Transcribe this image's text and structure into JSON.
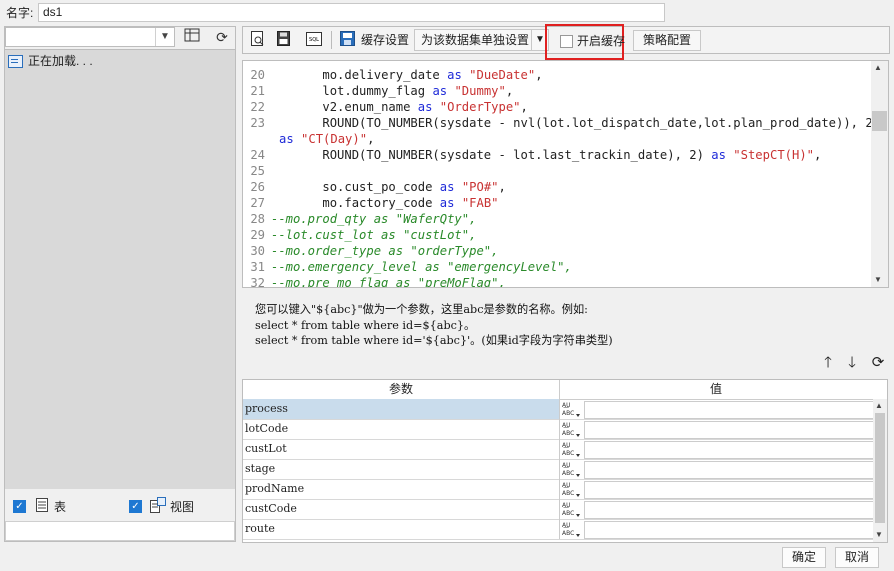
{
  "name_row": {
    "label": "名字:",
    "value": "ds1"
  },
  "left": {
    "db_select_value": "",
    "loading_text": "正在加载. . .",
    "table_check_label": "表",
    "view_check_label": "视图",
    "filter_value": ""
  },
  "toolbar": {
    "cache_settings_label": "缓存设置",
    "cache_mode_value": "为该数据集单独设置",
    "enable_cache_label": "开启缓存",
    "strategy_button_label": "策略配置"
  },
  "code_lines": [
    {
      "n": "20",
      "indent": "       ",
      "parts": [
        {
          "t": "mo.delivery_date ",
          "c": ""
        },
        {
          "t": "as",
          "c": "kw"
        },
        {
          "t": " ",
          "c": ""
        },
        {
          "t": "\"DueDate\"",
          "c": "str"
        },
        {
          "t": ",",
          "c": ""
        }
      ]
    },
    {
      "n": "21",
      "indent": "       ",
      "parts": [
        {
          "t": "lot.dummy_flag ",
          "c": ""
        },
        {
          "t": "as",
          "c": "kw"
        },
        {
          "t": " ",
          "c": ""
        },
        {
          "t": "\"Dummy\"",
          "c": "str"
        },
        {
          "t": ",",
          "c": ""
        }
      ]
    },
    {
      "n": "22",
      "indent": "       ",
      "parts": [
        {
          "t": "v2.enum_name ",
          "c": ""
        },
        {
          "t": "as",
          "c": "kw"
        },
        {
          "t": " ",
          "c": ""
        },
        {
          "t": "\"OrderType\"",
          "c": "str"
        },
        {
          "t": ",",
          "c": ""
        }
      ]
    },
    {
      "n": "23",
      "indent": "       ",
      "parts": [
        {
          "t": "ROUND(TO_NUMBER(sysdate - nvl(lot.lot_dispatch_date,lot.plan_prod_date)), 2)",
          "c": ""
        }
      ]
    },
    {
      "n": "",
      "indent": "",
      "parts": [
        {
          "t": "as",
          "c": "kw"
        },
        {
          "t": " ",
          "c": ""
        },
        {
          "t": "\"CT(Day)\"",
          "c": "str"
        },
        {
          "t": ",",
          "c": ""
        }
      ]
    },
    {
      "n": "24",
      "indent": "       ",
      "parts": [
        {
          "t": "ROUND(TO_NUMBER(sysdate - lot.last_trackin_date), 2) ",
          "c": ""
        },
        {
          "t": "as",
          "c": "kw"
        },
        {
          "t": " ",
          "c": ""
        },
        {
          "t": "\"StepCT(H)\"",
          "c": "str"
        },
        {
          "t": ",",
          "c": ""
        }
      ]
    },
    {
      "n": "25",
      "indent": "",
      "parts": []
    },
    {
      "n": "26",
      "indent": "       ",
      "parts": [
        {
          "t": "so.cust_po_code ",
          "c": ""
        },
        {
          "t": "as",
          "c": "kw"
        },
        {
          "t": " ",
          "c": ""
        },
        {
          "t": "\"PO#\"",
          "c": "str"
        },
        {
          "t": ",",
          "c": ""
        }
      ]
    },
    {
      "n": "27",
      "indent": "       ",
      "parts": [
        {
          "t": "mo.factory_code ",
          "c": ""
        },
        {
          "t": "as",
          "c": "kw"
        },
        {
          "t": " ",
          "c": ""
        },
        {
          "t": "\"FAB\"",
          "c": "str"
        }
      ]
    },
    {
      "n": "28",
      "indent": "",
      "parts": [
        {
          "t": "--mo.prod_qty as \"WaferQty\",",
          "c": "cm"
        }
      ]
    },
    {
      "n": "29",
      "indent": "",
      "parts": [
        {
          "t": "--lot.cust_lot as \"custLot\",",
          "c": "cm"
        }
      ]
    },
    {
      "n": "30",
      "indent": "",
      "parts": [
        {
          "t": "--mo.order_type as \"orderType\",",
          "c": "cm"
        }
      ]
    },
    {
      "n": "31",
      "indent": "",
      "parts": [
        {
          "t": "--mo.emergency_level as \"emergencyLevel\",",
          "c": "cm"
        }
      ]
    },
    {
      "n": "32",
      "indent": "",
      "parts": [
        {
          "t": "--mo.pre_mo_flag as \"preMoFlag\",",
          "c": "cm"
        }
      ]
    }
  ],
  "help": {
    "line1": "您可以键入\"${abc}\"做为一个参数，这里abc是参数的名称。例如:",
    "line2": "select * from table where id=${abc}。",
    "line3": "select * from table where id='${abc}'。(如果id字段为字符串类型)"
  },
  "params": {
    "col_param": "参数",
    "col_value": "值",
    "rows": [
      {
        "name": "process",
        "value": ""
      },
      {
        "name": "lotCode",
        "value": ""
      },
      {
        "name": "custLot",
        "value": ""
      },
      {
        "name": "stage",
        "value": ""
      },
      {
        "name": "prodName",
        "value": ""
      },
      {
        "name": "custCode",
        "value": ""
      },
      {
        "name": "route",
        "value": ""
      }
    ],
    "type_glyph": "A͟B\nABC"
  },
  "footer": {
    "ok_label": "确定",
    "cancel_label": "取消"
  },
  "colors": {
    "string": "#c83232",
    "keyword": "#1e2ad8",
    "comment": "#2a8a2a",
    "highlight_box": "#e02020",
    "selected_row": "#c9dcec"
  }
}
